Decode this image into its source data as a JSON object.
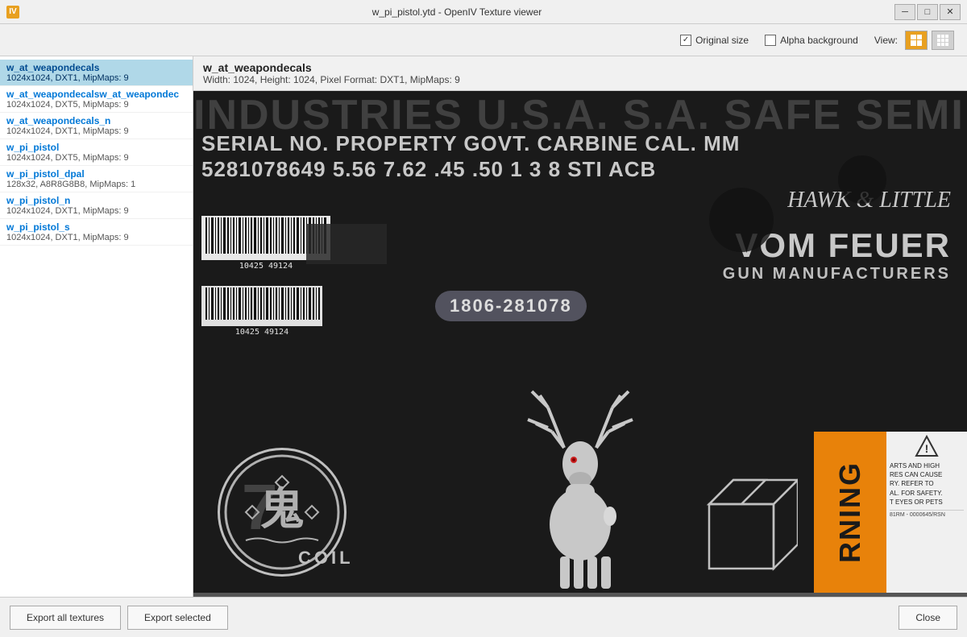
{
  "window": {
    "title": "w_pi_pistol.ytd - OpenIV Texture viewer",
    "icon": "IV"
  },
  "titlebar": {
    "minimize": "─",
    "maximize": "□",
    "close": "✕"
  },
  "toolbar": {
    "original_size_label": "Original size",
    "alpha_background_label": "Alpha background",
    "view_label": "View:",
    "original_size_checked": true,
    "alpha_background_checked": false
  },
  "sidebar": {
    "items": [
      {
        "name": "w_at_weapondecals",
        "info": "1024x1024, DXT1, MipMaps: 9",
        "selected": true
      },
      {
        "name": "w_at_weapondecalsw_at_weapondec",
        "info": "1024x1024, DXT5, MipMaps: 9",
        "selected": false
      },
      {
        "name": "w_at_weapondecals_n",
        "info": "1024x1024, DXT1, MipMaps: 9",
        "selected": false
      },
      {
        "name": "w_pi_pistol",
        "info": "1024x1024, DXT5, MipMaps: 9",
        "selected": false
      },
      {
        "name": "w_pi_pistol_dpal",
        "info": "128x32, A8R8G8B8, MipMaps: 1",
        "selected": false
      },
      {
        "name": "w_pi_pistol_n",
        "info": "1024x1024, DXT1, MipMaps: 9",
        "selected": false
      },
      {
        "name": "w_pi_pistol_s",
        "info": "1024x1024, DXT1, MipMaps: 9",
        "selected": false
      }
    ]
  },
  "texture": {
    "name": "w_at_weapondecals",
    "meta": "Width: 1024, Height: 1024, Pixel Format: DXT1, MipMaps: 9",
    "content": {
      "industries_text": "INDUSTRIES U.S.A. S.A. SAFE SEMI FULL",
      "serial_text": "SERIAL NO. PROPERTY GOVT. CARBINE CAL. MM",
      "numbers_text": "5281078649 5.56 7.62 .45 .50 1 3 8 STI ACB",
      "hawk_text": "Hawk & Little",
      "vom_feuer_text": "VOM FEUER",
      "gun_mfg_text": "GUN MANUFACTURERS",
      "serial_num": "1806-281078",
      "barcode_num1": "10425  49124",
      "barcode_num2": "10425  49124",
      "seven": "7",
      "coil": "COIL",
      "warning_text": "RNING",
      "warning_subtext": "ARTS AND HIGH\nRES CAN CAUSE\nRY. REFER TO\nAL. FOR SAFETY.\nT EYES OR PETS",
      "warning_code": "81RM - 0000645/RSN"
    }
  },
  "footer": {
    "export_all_label": "Export all textures",
    "export_selected_label": "Export selected",
    "close_label": "Close"
  }
}
